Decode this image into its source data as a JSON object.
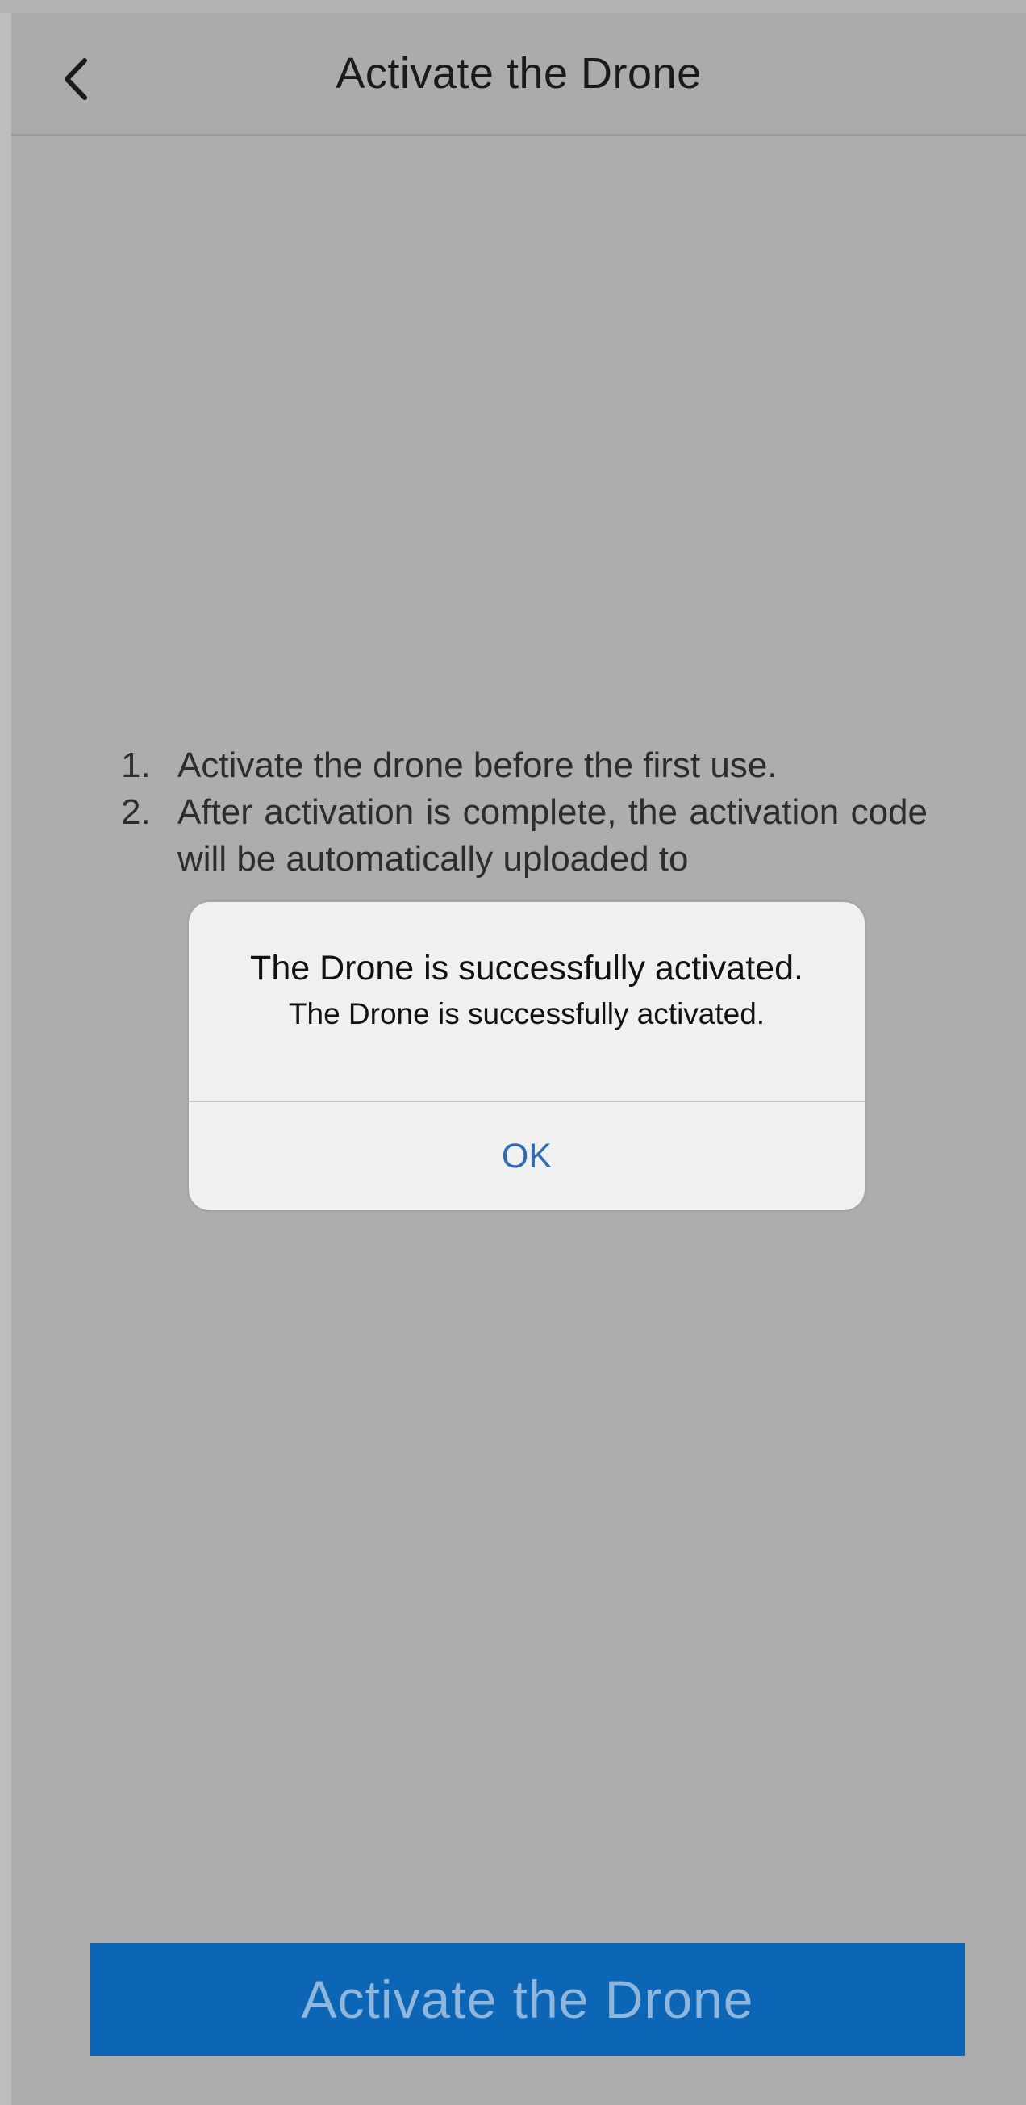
{
  "nav": {
    "title": "Activate the Drone",
    "back_icon": "chevron-left-icon"
  },
  "instructions": [
    {
      "number": "1.",
      "text": "Activate the drone before the first use."
    },
    {
      "number": "2.",
      "text": "After activation is complete, the activation code will be automatically uploaded to"
    }
  ],
  "dialog": {
    "title": "The Drone is successfully activated.",
    "message": "The Drone is successfully activated.",
    "ok_label": "OK",
    "ok_color": "#2f6bb0"
  },
  "footer": {
    "activate_label": "Activate the Drone",
    "button_color": "#0d65b5"
  }
}
